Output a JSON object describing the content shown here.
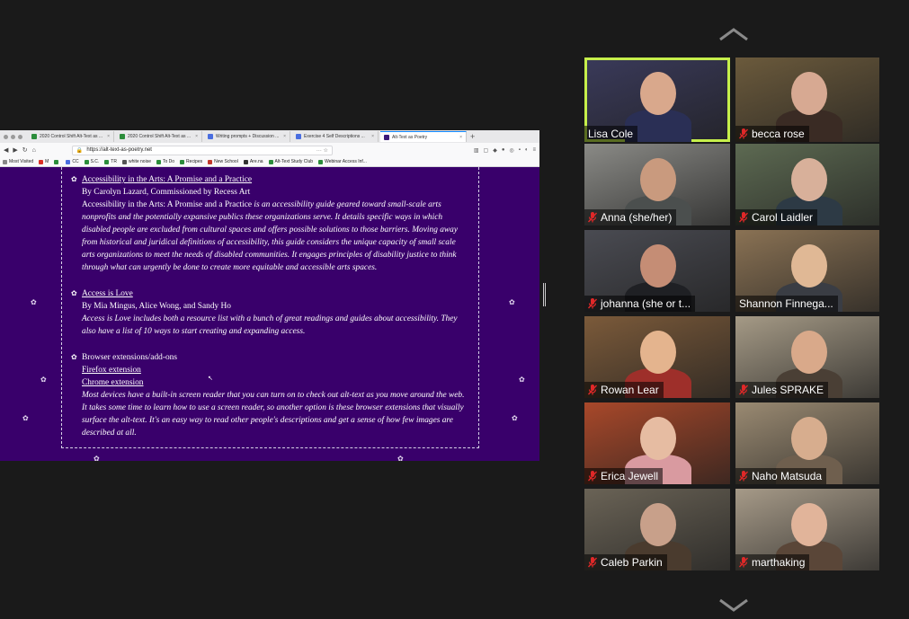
{
  "browser": {
    "tabs": [
      {
        "label": "2020 Control Shift Alt-Text as ...",
        "color": "#2c8d3b"
      },
      {
        "label": "2020 Control Shift Alt-Text as ...",
        "color": "#2c8d3b"
      },
      {
        "label": "Writing prompts + Discussion ...",
        "color": "#4a6ee0"
      },
      {
        "label": "Exercise 4 Self Descriptions ...",
        "color": "#4a6ee0"
      },
      {
        "label": "Alt-Text as Poetry",
        "color": "#3c1a7a"
      }
    ],
    "url": "https://alt-text-as-poetry.net",
    "bookmarks": [
      {
        "label": "Most Visited",
        "color": "#888"
      },
      {
        "label": "M",
        "color": "#d93025"
      },
      {
        "label": "",
        "color": "#2c8d3b"
      },
      {
        "label": "CC",
        "color": "#4a6ee0"
      },
      {
        "label": "S.C.",
        "color": "#2c8d3b"
      },
      {
        "label": "TR",
        "color": "#2c8d3b"
      },
      {
        "label": "white noise",
        "color": "#555"
      },
      {
        "label": "To Do",
        "color": "#2c8d3b"
      },
      {
        "label": "Recipes",
        "color": "#2c8d3b"
      },
      {
        "label": "New School",
        "color": "#c0392b"
      },
      {
        "label": "Are.na",
        "color": "#333"
      },
      {
        "label": "Alt-Text Study Club",
        "color": "#2c8d3b"
      },
      {
        "label": "Webinar Access Inf...",
        "color": "#2c8d3b"
      }
    ]
  },
  "page": {
    "entries": [
      {
        "title": "Accessibility in the Arts: A Promise and a Practice",
        "byline": "By Carolyn Lazard, Commissioned by Recess Art",
        "desc_lead": "Accessibility in the Arts: A Promise and a Practice",
        "desc_rest": " is an accessibility guide geared toward small-scale arts nonprofits and the potentially expansive publics these organizations serve. It details specific ways in which disabled people are excluded from cultural spaces and offers possible solutions to those barriers. Moving away from historical and juridical definitions of accessibility, this guide considers the unique capacity of small scale arts organizations to meet the needs of disabled communities. It engages principles of disability justice to think through what can urgently be done to create more equitable and accessible arts spaces."
      },
      {
        "title": "Access is Love",
        "byline": "By Mia Mingus, Alice Wong, and Sandy Ho",
        "desc": "Access is Love includes both a resource list with a bunch of great readings and guides about accessibility. They also have a list of 10 ways to start creating and expanding access."
      },
      {
        "title": "Browser extensions/add-ons",
        "links": [
          "Firefox extension",
          "Chrome extension"
        ],
        "desc": "Most devices have a built-in screen reader that you can turn on to check out alt-text as you move around the web. It takes some time to learn how to use a screen reader, so another option is these browser extensions that visually surface the alt-text. It's an easy way to read other people's descriptions and get a sense of how few images are described at all."
      }
    ]
  },
  "participants": [
    {
      "name": "Lisa Cole",
      "muted": false,
      "active": true,
      "bg": "#3a3a5a",
      "skin": "#d9a88c",
      "shirt": "#2a2f55"
    },
    {
      "name": "becca rose",
      "muted": true,
      "active": false,
      "bg": "#6b5a3c",
      "skin": "#d7a992",
      "shirt": "#3a2b24"
    },
    {
      "name": "Anna (she/her)",
      "muted": true,
      "active": false,
      "bg": "#8a8a86",
      "skin": "#c99a7e",
      "shirt": "#4b4f4e"
    },
    {
      "name": "Carol Laidler",
      "muted": true,
      "active": false,
      "bg": "#5d6a52",
      "skin": "#d8b09a",
      "shirt": "#2d3a45"
    },
    {
      "name": "johanna (she or t...",
      "muted": true,
      "active": false,
      "bg": "#4a4b52",
      "skin": "#c58d75",
      "shirt": "#1f2024"
    },
    {
      "name": "Shannon Finnega...",
      "muted": false,
      "active": false,
      "bg": "#8a7254",
      "skin": "#e0b895",
      "shirt": "#3a3d44"
    },
    {
      "name": "Rowan Lear",
      "muted": true,
      "active": false,
      "bg": "#7b5a3a",
      "skin": "#e4b48e",
      "shirt": "#9e2f2a"
    },
    {
      "name": "Jules SPRAKE",
      "muted": true,
      "active": false,
      "bg": "#a59a86",
      "skin": "#d9a98a",
      "shirt": "#4a3f35"
    },
    {
      "name": "Erica Jewell",
      "muted": true,
      "active": false,
      "bg": "#a8482a",
      "skin": "#e6bca2",
      "shirt": "#d99aa0"
    },
    {
      "name": "Naho Matsuda",
      "muted": true,
      "active": false,
      "bg": "#9a8a72",
      "skin": "#d7ad8e",
      "shirt": "#6f5f4e"
    },
    {
      "name": "Caleb Parkin",
      "muted": true,
      "active": false,
      "bg": "#6a6356",
      "skin": "#c8a08a",
      "shirt": "#4a3b2e"
    },
    {
      "name": "marthaking",
      "muted": true,
      "active": false,
      "bg": "#a69a88",
      "skin": "#e1b49a",
      "shirt": "#5a4638"
    }
  ],
  "colors": {
    "background": "#1a1a1a",
    "share_bg": "#39006b",
    "active_speaker": "#c6ef4b",
    "muted_icon": "#e02828"
  }
}
